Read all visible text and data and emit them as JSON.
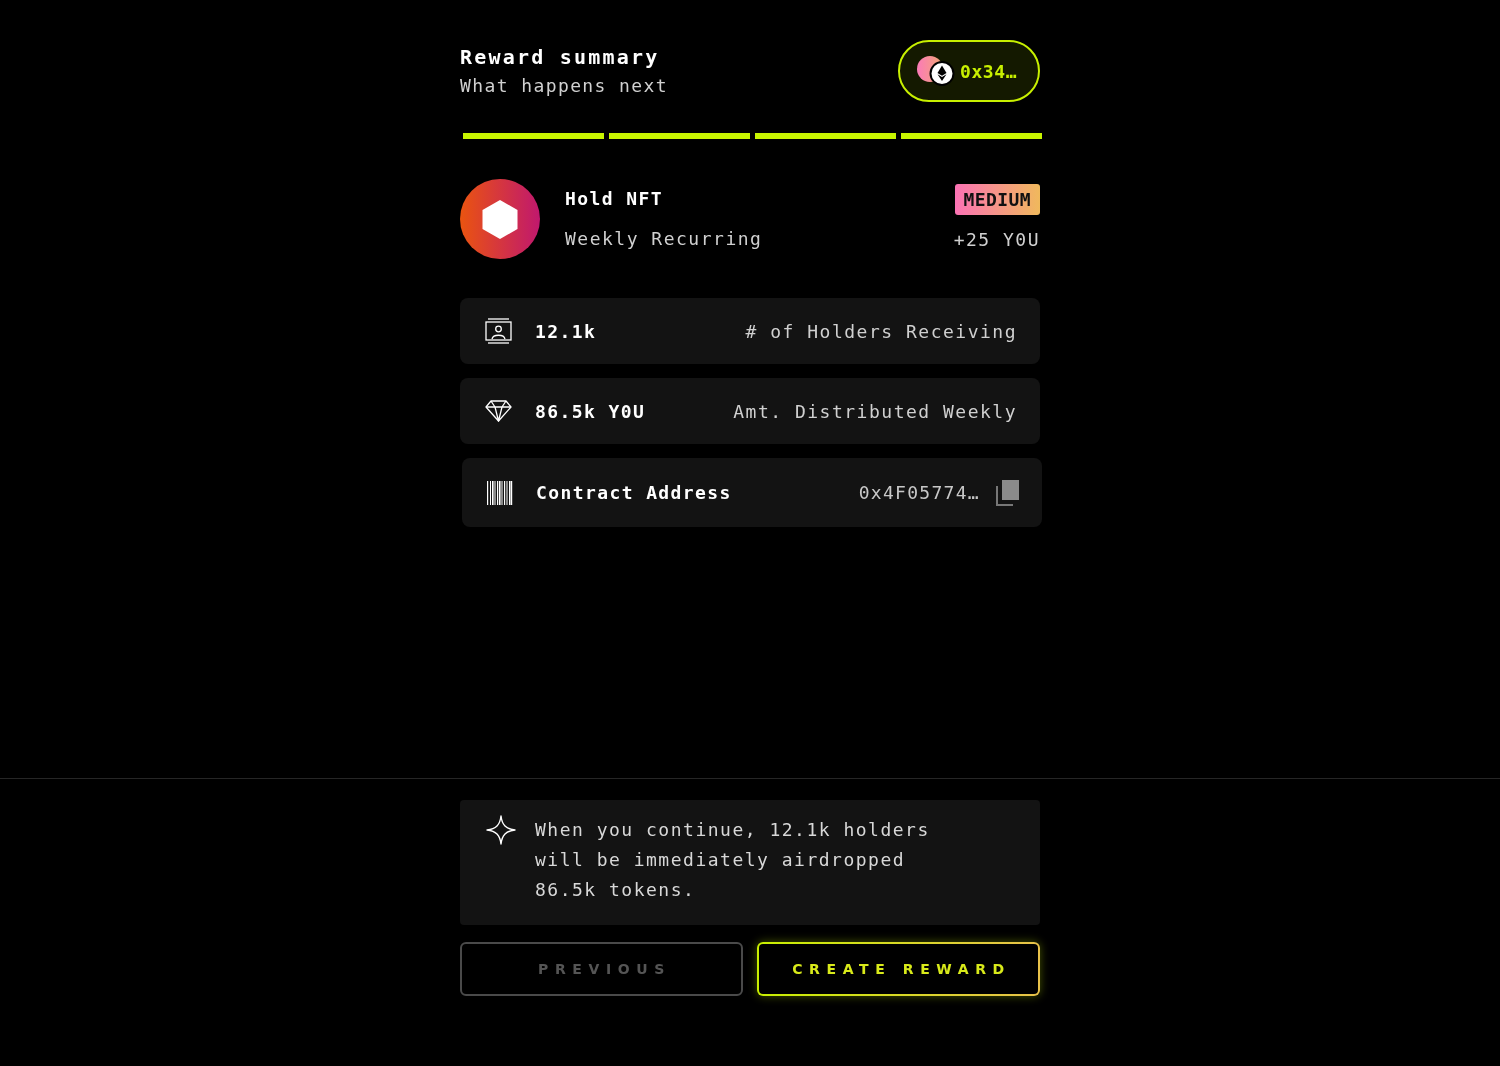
{
  "header": {
    "title": "Reward summary",
    "subtitle": "What happens next",
    "wallet": {
      "address": "0x34…"
    }
  },
  "progress": {
    "steps": [
      {
        "done": true
      },
      {
        "done": true
      },
      {
        "done": true
      },
      {
        "done": true
      }
    ]
  },
  "reward": {
    "title": "Hold NFT",
    "schedule": "Weekly Recurring",
    "difficulty": "MEDIUM",
    "amount": "+25 Y0U"
  },
  "details": [
    {
      "kind": "stat",
      "value": "12.1k",
      "label": "# of Holders Receiving"
    },
    {
      "kind": "stat",
      "value": "86.5k Y0U",
      "label": "Amt. Distributed Weekly"
    },
    {
      "kind": "address",
      "label": "Contract Address",
      "value": "0x4F05774…"
    }
  ],
  "notice": {
    "text": "When you continue, 12.1k holders will be immediately airdropped 86.5k tokens."
  },
  "buttons": [
    {
      "label": "PREVIOUS",
      "disabled": true
    },
    {
      "label": "CREATE REWARD",
      "disabled": false
    }
  ]
}
